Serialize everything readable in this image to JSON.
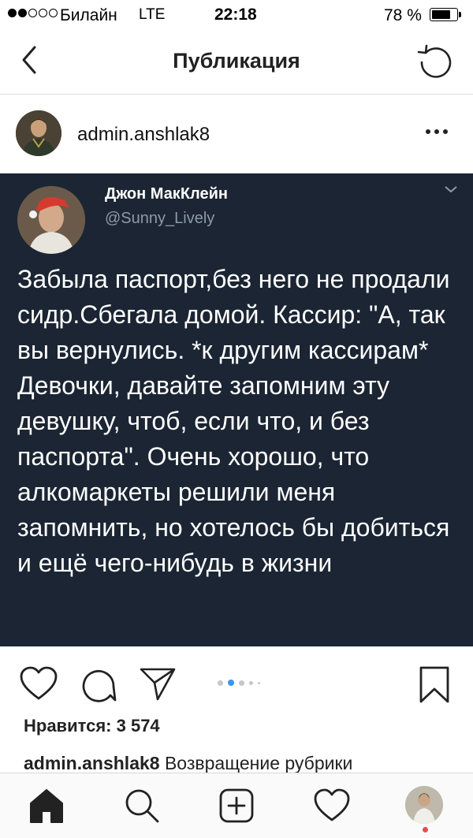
{
  "status_bar": {
    "carrier": "Билайн",
    "network": "LTE",
    "time": "22:18",
    "battery": "78 %",
    "battery_level": 0.78
  },
  "nav": {
    "title": "Публикация",
    "back_icon": "chevron-left-icon",
    "refresh_icon": "refresh-icon"
  },
  "post": {
    "username": "admin.anshlak8",
    "tweet": {
      "name": "Джон МакКлейн",
      "handle": "@Sunny_Lively",
      "text": "Забыла паспорт,без него не продали сидр.Сбегала домой. Кассир: \"А, так вы вернулись. *к другим кассирам* Девочки, давайте запомним эту девушку, чтоб, если что, и без паспорта\". Очень хорошо, что алкомаркеты решили меня запомнить, но хотелось бы добиться и ещё чего-нибудь в жизни"
    },
    "carousel": {
      "count": 5,
      "active_index": 1
    },
    "likes": "Нравится: 3 574",
    "caption_user": "admin.anshlak8",
    "caption_text": "Возвращение рубрики"
  },
  "colors": {
    "tweet_background": "#1b2533",
    "accent": "#3897f0",
    "notification": "#ed4956"
  },
  "tabbar": {
    "items": [
      "home-icon",
      "search-icon",
      "add-icon",
      "heart-icon",
      "profile-avatar"
    ]
  }
}
